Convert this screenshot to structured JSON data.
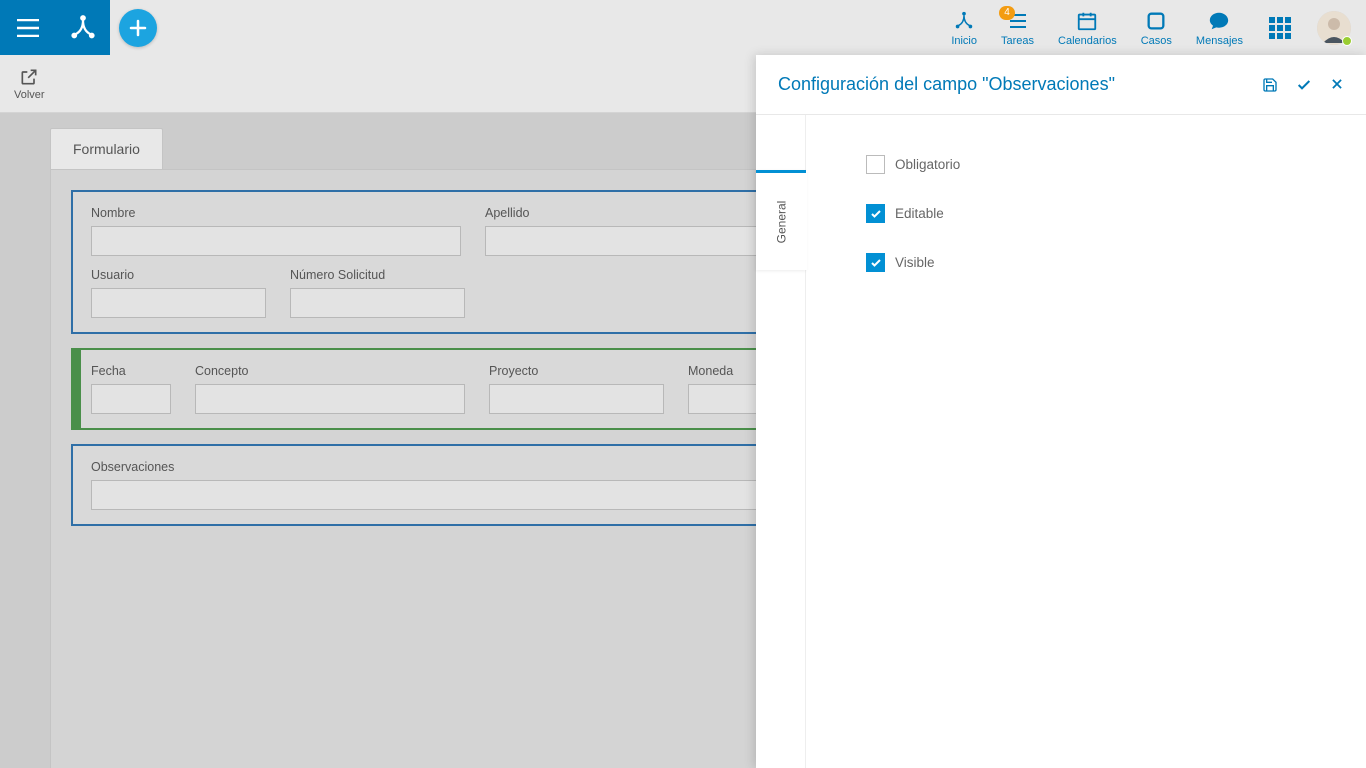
{
  "nav": {
    "inicio": "Inicio",
    "tareas": "Tareas",
    "tareas_badge": "4",
    "calendarios": "Calendarios",
    "casos": "Casos",
    "mensajes": "Mensajes"
  },
  "back_label": "Volver",
  "tab_label": "Formulario",
  "fields": {
    "nombre": "Nombre",
    "apellido": "Apellido",
    "usuario": "Usuario",
    "numero_solicitud": "Número Solicitud",
    "fecha": "Fecha",
    "concepto": "Concepto",
    "proyecto": "Proyecto",
    "moneda": "Moneda",
    "observaciones": "Observaciones"
  },
  "panel": {
    "title": "Configuración del campo \"Observaciones\"",
    "tab_general": "General",
    "opt_obligatorio": "Obligatorio",
    "opt_editable": "Editable",
    "opt_visible": "Visible",
    "obligatorio_checked": false,
    "editable_checked": true,
    "visible_checked": true
  }
}
